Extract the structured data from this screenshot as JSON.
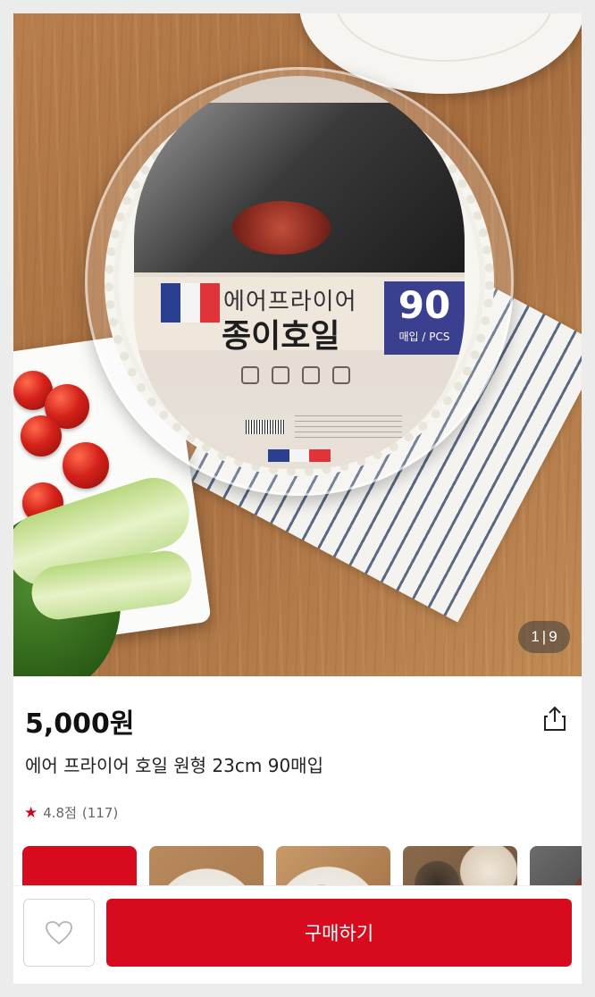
{
  "product_image": {
    "counter_current": "1",
    "counter_total": "9",
    "package": {
      "title_line1": "에어프라이어",
      "title_line2": "종이호일",
      "count": "90",
      "count_unit": "매입 / PCS"
    }
  },
  "product": {
    "price": "5,000원",
    "name": "에어 프라이어 호일 원형 23cm 90매입",
    "rating": "4.8점",
    "review_count": "(117)"
  },
  "thumbnails": [
    {
      "kind": "promo",
      "color": "#d80b1e"
    },
    {
      "kind": "photo"
    },
    {
      "kind": "photo"
    },
    {
      "kind": "photo"
    },
    {
      "kind": "photo"
    }
  ],
  "actions": {
    "buy_label": "구매하기",
    "wish_icon": "heart-outline-icon",
    "share_icon": "share-icon"
  },
  "colors": {
    "accent": "#d80b1e",
    "star": "#d4051a",
    "text": "#222222"
  }
}
